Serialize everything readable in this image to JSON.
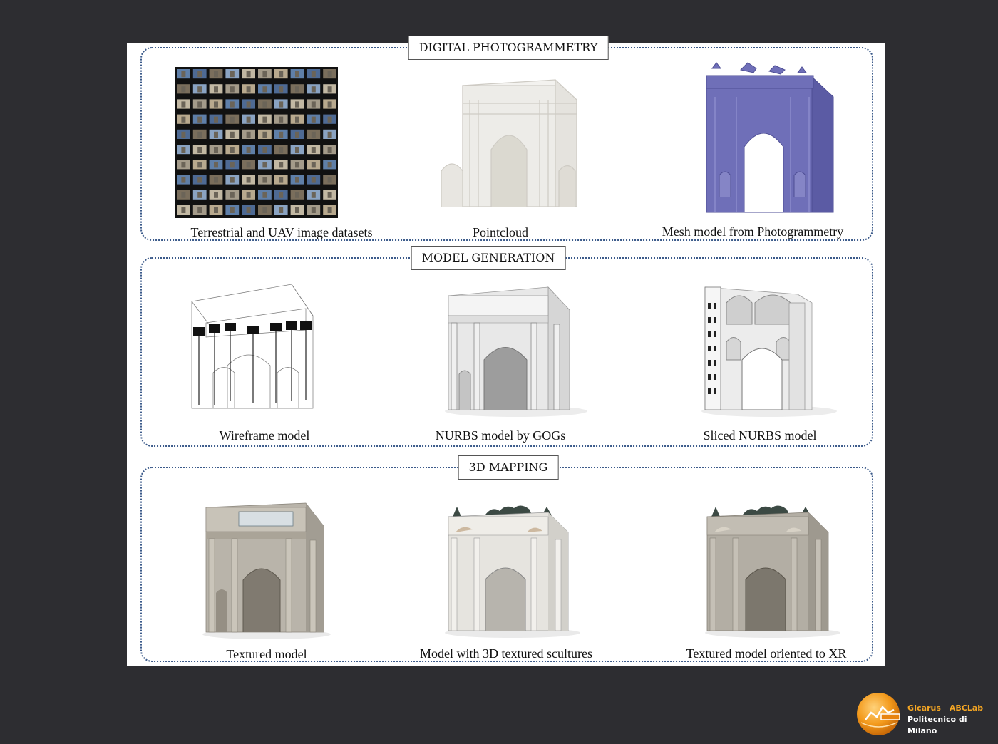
{
  "panels": [
    {
      "title": "DIGITAL PHOTOGRAMMETRY",
      "captions": [
        "Terrestrial and UAV image datasets",
        "Pointcloud",
        "Mesh model from Photogrammetry"
      ]
    },
    {
      "title": "MODEL GENERATION",
      "captions": [
        "Wireframe model",
        "NURBS model by GOGs",
        "Sliced NURBS model"
      ]
    },
    {
      "title": "3D MAPPING",
      "captions": [
        "Textured model",
        "Model with 3D textured scultures",
        "Textured model oriented to XR"
      ]
    }
  ],
  "logo": {
    "org1": "GIcarus",
    "org2": "ABCLab",
    "institution": "Politecnico di Milano"
  },
  "colors": {
    "background": "#2d2d31",
    "panel_border": "#3b5a8a",
    "mesh_blue": "#6f6fb8",
    "logo_orange": "#f5a623"
  }
}
